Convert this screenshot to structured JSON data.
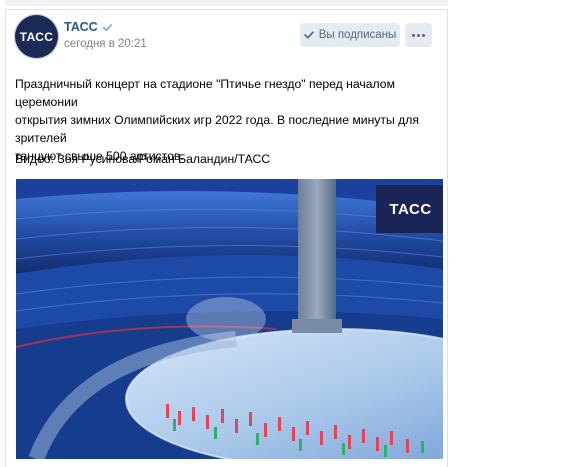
{
  "post": {
    "author": "ТАСС",
    "avatar_text": "ТАСС",
    "time": "сегодня в 20:21",
    "subscribe_label": "Вы подписаны",
    "text_lines": [
      "Праздничный концерт на стадионе \"Птичье гнездо\" перед началом церемонии",
      "открытия зимних Олимпийских игр 2022 года. В последние минуты для зрителей",
      "танцуют свыше 500 артистов."
    ],
    "credit": "Видео: Зоя Русинова/Роман Баландин/ТАСС",
    "video_logo": "ТАСС"
  },
  "colors": {
    "link": "#2a5885",
    "button_bg": "#e5ebf1",
    "avatar_bg": "#1b2a57"
  },
  "icons": {
    "verified": "verified-check-icon",
    "subscribed": "checkmark-icon",
    "more": "more-dots-icon"
  }
}
